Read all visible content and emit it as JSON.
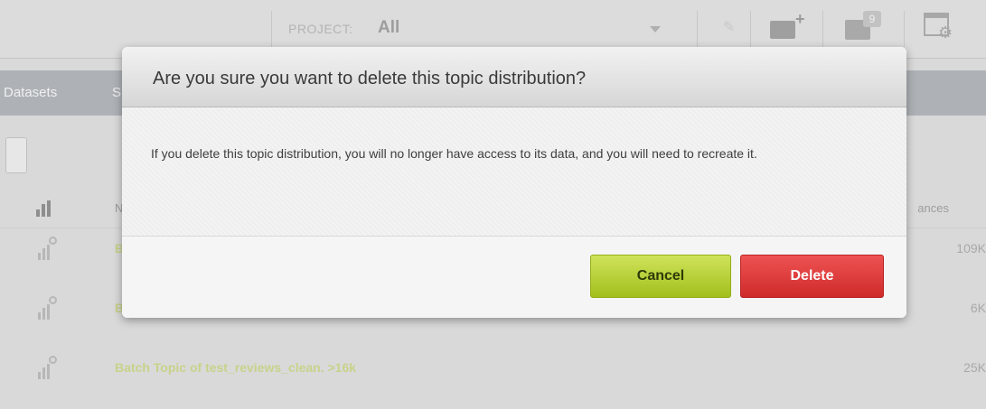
{
  "topbar": {
    "project_label": "PROJECT:",
    "project_value": "All",
    "folder_badge": "9"
  },
  "nav": {
    "datasets": "Datasets",
    "partial_tab": "S"
  },
  "table": {
    "header_name_partial": "N",
    "header_instances_partial": "ances",
    "rows": [
      {
        "name": "B",
        "value": "109K"
      },
      {
        "name": "B",
        "value": "6K"
      },
      {
        "name": "Batch Topic of test_reviews_clean. >16k",
        "value": "25K"
      }
    ]
  },
  "modal": {
    "title": "Are you sure you want to delete this topic distribution?",
    "message": "If you delete this topic distribution, you will no longer have access to its data, and you will need to recreate it.",
    "cancel_label": "Cancel",
    "delete_label": "Delete"
  },
  "colors": {
    "cancel": "#b4cf2a",
    "delete": "#e03c3c",
    "link": "#c9d28a"
  }
}
